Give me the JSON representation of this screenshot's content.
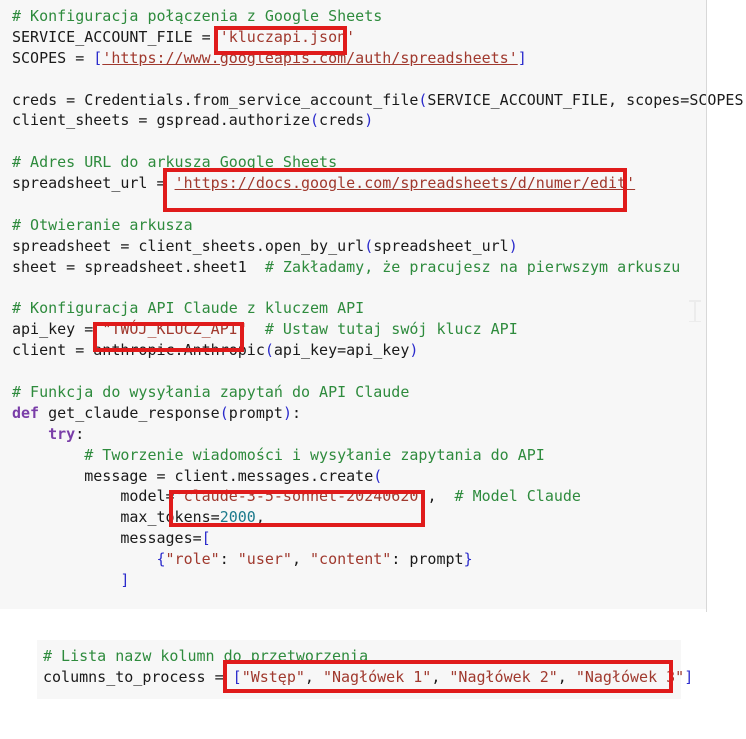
{
  "document": {
    "language": "python",
    "background_color": "#ffffff",
    "code_block_color": "#f7f7f7",
    "annotation_color": "#e01b1b",
    "comment_color": "#2e8b3d",
    "string_color": "#a0392e",
    "keyword_color": "#7a3ea8",
    "punct_color": "#2b2bcc",
    "number_color": "#1c7a8c"
  },
  "code_main": {
    "lines": [
      {
        "id": "l1",
        "text": "# Konfiguracja połączenia z Google Sheets"
      },
      {
        "id": "l2",
        "text": "SERVICE_ACCOUNT_FILE = 'kluczapi.json'"
      },
      {
        "id": "l3",
        "text": "SCOPES = ['https://www.googleapis.com/auth/spreadsheets']"
      },
      {
        "id": "l4",
        "text": ""
      },
      {
        "id": "l5",
        "text": "creds = Credentials.from_service_account_file(SERVICE_ACCOUNT_FILE, scopes=SCOPES)"
      },
      {
        "id": "l6",
        "text": "client_sheets = gspread.authorize(creds)"
      },
      {
        "id": "l7",
        "text": ""
      },
      {
        "id": "l8",
        "text": "# Adres URL do arkusza Google Sheets"
      },
      {
        "id": "l9",
        "text": "spreadsheet_url = 'https://docs.google.com/spreadsheets/d/numer/edit'"
      },
      {
        "id": "l10",
        "text": ""
      },
      {
        "id": "l11",
        "text": "# Otwieranie arkusza"
      },
      {
        "id": "l12",
        "text": "spreadsheet = client_sheets.open_by_url(spreadsheet_url)"
      },
      {
        "id": "l13",
        "text": "sheet = spreadsheet.sheet1  # Zakładamy, że pracujesz na pierwszym arkuszu"
      },
      {
        "id": "l14",
        "text": ""
      },
      {
        "id": "l15",
        "text": "# Konfiguracja API Claude z kluczem API"
      },
      {
        "id": "l16",
        "text": "api_key = \"TWÓJ_KLUCZ_API\"  # Ustaw tutaj swój klucz API"
      },
      {
        "id": "l17",
        "text": "client = anthropic.Anthropic(api_key=api_key)"
      },
      {
        "id": "l18",
        "text": ""
      },
      {
        "id": "l19",
        "text": "# Funkcja do wysyłania zapytań do API Claude"
      },
      {
        "id": "l20",
        "text": "def get_claude_response(prompt):"
      },
      {
        "id": "l21",
        "text": "    try:"
      },
      {
        "id": "l22",
        "text": "        # Tworzenie wiadomości i wysyłanie zapytania do API"
      },
      {
        "id": "l23",
        "text": "        message = client.messages.create("
      },
      {
        "id": "l24",
        "text": "            model='claude-3-5-sonnet-20240620\",  # Model Claude"
      },
      {
        "id": "l25",
        "text": "            max_tokens=2000,"
      },
      {
        "id": "l26",
        "text": "            messages=["
      },
      {
        "id": "l27",
        "text": "                {\"role\": \"user\", \"content\": prompt}"
      },
      {
        "id": "l28",
        "text": "            ]"
      }
    ]
  },
  "code_columns": {
    "lines": [
      {
        "id": "c1",
        "text": "# Lista nazw kolumn do przetworzenia"
      },
      {
        "id": "c2",
        "text": "columns_to_process = [\"Wstęp\", \"Nagłówek 1\", \"Nagłówek 2\", \"Nagłówek 3\"]"
      }
    ]
  },
  "annotations": [
    {
      "id": "a1",
      "label": "service-account-file-value",
      "highlighted_text": "'kluczapi.json'"
    },
    {
      "id": "a2",
      "label": "spreadsheet-url-value",
      "highlighted_text": "'https://docs.google.com/spreadsheets/d/numer/edit'"
    },
    {
      "id": "a3",
      "label": "api-key-value",
      "highlighted_text": "\"TWÓJ_KLUCZ_API\""
    },
    {
      "id": "a4",
      "label": "model-name-value",
      "highlighted_text": "'claude-3-5-sonnet-20240620\","
    },
    {
      "id": "a5",
      "label": "columns-to-process-value",
      "highlighted_text": "[\"Wstęp\", \"Nagłówek 1\", \"Nagłówek 2\", \"Nagłówek 3\"]"
    }
  ]
}
